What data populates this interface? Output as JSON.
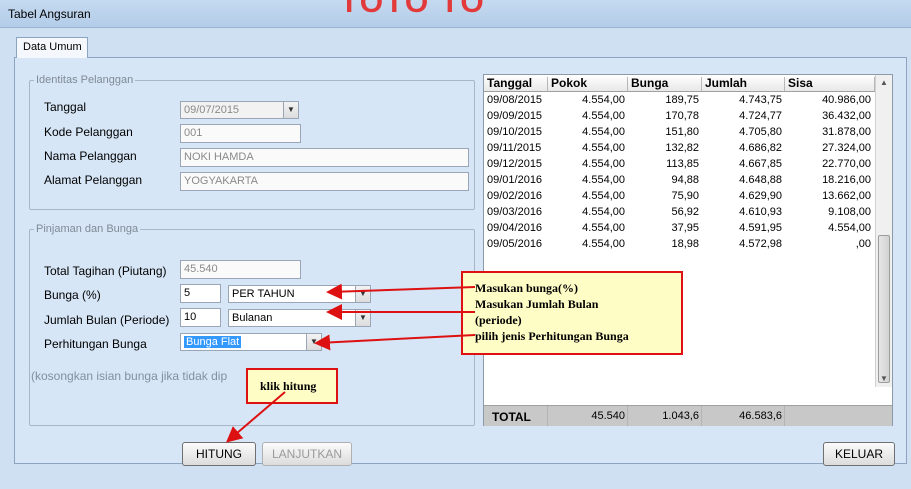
{
  "window": {
    "title": "Tabel Angsuran",
    "brand_fragment": "TOTO TO"
  },
  "tabs": [
    {
      "label": "Data Umum"
    }
  ],
  "identitas": {
    "legend": "Identitas Pelanggan",
    "tanggal_label": "Tanggal",
    "tanggal_value": "09/07/2015",
    "kode_label": "Kode Pelanggan",
    "kode_value": "001",
    "nama_label": "Nama Pelanggan",
    "nama_value": "NOKI HAMDA",
    "alamat_label": "Alamat Pelanggan",
    "alamat_value": "YOGYAKARTA"
  },
  "pinjaman": {
    "legend": "Pinjaman dan Bunga",
    "total_label": "Total Tagihan (Piutang)",
    "total_value": "45.540",
    "bunga_label": "Bunga (%)",
    "bunga_value": "5",
    "bunga_period": "PER TAHUN",
    "jumlah_label": "Jumlah Bulan (Periode)",
    "jumlah_value": "10",
    "jumlah_unit": "Bulanan",
    "perhitungan_label": "Perhitungan Bunga",
    "perhitungan_value": "Bunga Flat",
    "hint": "(kosongkan isian bunga jika tidak dip"
  },
  "table": {
    "columns": [
      "Tanggal",
      "Pokok",
      "Bunga",
      "Jumlah",
      "Sisa"
    ],
    "rows": [
      [
        "09/08/2015",
        "4.554,00",
        "189,75",
        "4.743,75",
        "40.986,00"
      ],
      [
        "09/09/2015",
        "4.554,00",
        "170,78",
        "4.724,77",
        "36.432,00"
      ],
      [
        "09/10/2015",
        "4.554,00",
        "151,80",
        "4.705,80",
        "31.878,00"
      ],
      [
        "09/11/2015",
        "4.554,00",
        "132,82",
        "4.686,82",
        "27.324,00"
      ],
      [
        "09/12/2015",
        "4.554,00",
        "113,85",
        "4.667,85",
        "22.770,00"
      ],
      [
        "09/01/2016",
        "4.554,00",
        "94,88",
        "4.648,88",
        "18.216,00"
      ],
      [
        "09/02/2016",
        "4.554,00",
        "75,90",
        "4.629,90",
        "13.662,00"
      ],
      [
        "09/03/2016",
        "4.554,00",
        "56,92",
        "4.610,93",
        "9.108,00"
      ],
      [
        "09/04/2016",
        "4.554,00",
        "37,95",
        "4.591,95",
        "4.554,00"
      ],
      [
        "09/05/2016",
        "4.554,00",
        "18,98",
        "4.572,98",
        ",00"
      ]
    ],
    "total": {
      "label": "TOTAL",
      "pokok": "45.540",
      "bunga": "1.043,6",
      "jumlah": "46.583,6"
    }
  },
  "buttons": {
    "hitung": "HITUNG",
    "lanjutkan": "LANJUTKAN",
    "keluar": "KELUAR"
  },
  "callouts": {
    "main": [
      "Masukan bunga(%)",
      "Masukan Jumlah Bulan",
      "(periode)",
      "pilih jenis Perhitungan Bunga"
    ],
    "hitung": "klik hitung"
  },
  "colors": {
    "callout_border": "#dd1111",
    "callout_fill": "#fffdc6",
    "arrow": "#dd1111"
  }
}
